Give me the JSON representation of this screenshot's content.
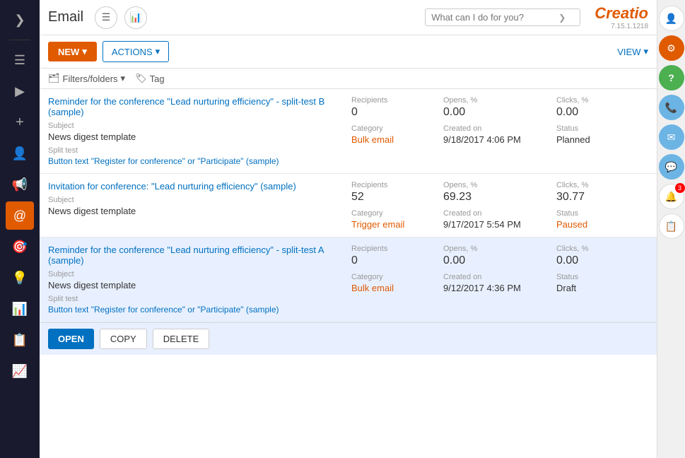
{
  "app": {
    "title": "Email",
    "logo": "Creatio",
    "version": "7.15.1.1218"
  },
  "search": {
    "placeholder": "What can I do for you?"
  },
  "toolbar": {
    "new_label": "NEW",
    "new_arrow": "▾",
    "actions_label": "ACTIONS",
    "actions_arrow": "▾",
    "view_label": "VIEW",
    "view_arrow": "▾"
  },
  "filters": {
    "filter_label": "Filters/folders",
    "filter_arrow": "▾",
    "tag_label": "Tag"
  },
  "columns": {
    "recipients": "Recipients",
    "opens": "Opens, %",
    "clicks": "Clicks, %",
    "category": "Category",
    "created_on": "Created on",
    "status": "Status",
    "subject": "Subject",
    "split_test": "Split test"
  },
  "rows": [
    {
      "id": 1,
      "title": "Reminder for the conference \"Lead nurturing efficiency\" - split-test B (sample)",
      "subject_label": "Subject",
      "subject_value": "News digest template",
      "split_test_label": "Split test",
      "split_test_value": "Button text \"Register for conference\" or \"Participate\" (sample)",
      "recipients_label": "Recipients",
      "recipients_value": "0",
      "opens_label": "Opens, %",
      "opens_value": "0.00",
      "clicks_label": "Clicks, %",
      "clicks_value": "0.00",
      "category_label": "Category",
      "category_value": "Bulk email",
      "category_class": "bulk",
      "created_label": "Created on",
      "created_value": "9/18/2017 4:06 PM",
      "status_label": "Status",
      "status_value": "Planned",
      "status_class": "planned",
      "selected": false
    },
    {
      "id": 2,
      "title": "Invitation for conference: \"Lead nurturing efficiency\" (sample)",
      "subject_label": "Subject",
      "subject_value": "News digest template",
      "split_test_label": "",
      "split_test_value": "",
      "recipients_label": "Recipients",
      "recipients_value": "52",
      "opens_label": "Opens, %",
      "opens_value": "69.23",
      "clicks_label": "Clicks, %",
      "clicks_value": "30.77",
      "category_label": "Category",
      "category_value": "Trigger email",
      "category_class": "trigger",
      "created_label": "Created on",
      "created_value": "9/17/2017 5:54 PM",
      "status_label": "Status",
      "status_value": "Paused",
      "status_class": "paused",
      "selected": false
    },
    {
      "id": 3,
      "title": "Reminder for the conference \"Lead nurturing efficiency\" - split-test A (sample)",
      "subject_label": "Subject",
      "subject_value": "News digest template",
      "split_test_label": "Split test",
      "split_test_value": "Button text \"Register for conference\" or \"Participate\" (sample)",
      "recipients_label": "Recipients",
      "recipients_value": "0",
      "opens_label": "Opens, %",
      "opens_value": "0.00",
      "clicks_label": "Clicks, %",
      "clicks_value": "0.00",
      "category_label": "Category",
      "category_value": "Bulk email",
      "category_class": "bulk",
      "created_label": "Created on",
      "created_value": "9/12/2017 4:36 PM",
      "status_label": "Status",
      "status_value": "Draft",
      "status_class": "draft",
      "selected": true
    }
  ],
  "row_actions": {
    "open": "OPEN",
    "copy": "COPY",
    "delete": "DELETE"
  },
  "left_nav": {
    "items": [
      {
        "icon": "❯",
        "name": "expand"
      },
      {
        "icon": "☰",
        "name": "menu"
      },
      {
        "icon": "▶",
        "name": "play"
      },
      {
        "icon": "+",
        "name": "add"
      },
      {
        "icon": "👤",
        "name": "user"
      },
      {
        "icon": "📢",
        "name": "broadcast"
      },
      {
        "icon": "@",
        "name": "email-active"
      },
      {
        "icon": "🎯",
        "name": "target"
      },
      {
        "icon": "💡",
        "name": "idea"
      },
      {
        "icon": "📊",
        "name": "analytics"
      },
      {
        "icon": "📋",
        "name": "list"
      },
      {
        "icon": "📈",
        "name": "chart"
      }
    ]
  },
  "right_sidebar": {
    "items": [
      {
        "icon": "👤",
        "name": "profile"
      },
      {
        "icon": "⚙",
        "name": "settings"
      },
      {
        "icon": "?",
        "name": "help"
      },
      {
        "icon": "📞",
        "name": "phone"
      },
      {
        "icon": "✉",
        "name": "mail"
      },
      {
        "icon": "💬",
        "name": "chat"
      },
      {
        "icon": "🔔",
        "name": "notifications",
        "badge": "3"
      },
      {
        "icon": "📋",
        "name": "clipboard"
      }
    ]
  },
  "notification_count": "3"
}
